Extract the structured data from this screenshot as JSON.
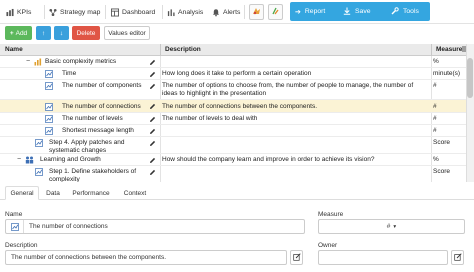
{
  "nav": {
    "kpis": "KPIs",
    "strategy_map": "Strategy map",
    "dashboard": "Dashboard",
    "analysis": "Analysis",
    "alerts": "Alerts",
    "report": "Report",
    "save": "Save",
    "tools": "Tools"
  },
  "toolbar": {
    "add": "Add",
    "delete": "Delete",
    "values_editor": "Values editor"
  },
  "table": {
    "headers": {
      "name": "Name",
      "description": "Description",
      "measure": "Measure"
    },
    "rows": [
      {
        "name": "Basic complexity metrics",
        "description": "",
        "measure": "%"
      },
      {
        "name": "Time",
        "description": "How long does it take to perform a certain operation",
        "measure": "minute(s)"
      },
      {
        "name": "The number of components",
        "description": "The number of options to choose from, the number of people to manage, the number of ideas to highlight in the presentation",
        "measure": "#"
      },
      {
        "name": "The number of connections",
        "description": "The number of connections between the components.",
        "measure": "#"
      },
      {
        "name": "The number of levels",
        "description": "The number of levels to deal with",
        "measure": "#"
      },
      {
        "name": "Shortest message length",
        "description": "",
        "measure": "#"
      },
      {
        "name": "Step 4. Apply patches and systematic changes",
        "description": "",
        "measure": "Score"
      },
      {
        "name": "Learning and Growth",
        "description": "How should the company learn and improve in order to achieve its vision?",
        "measure": "%"
      },
      {
        "name": "Step 1. Define stakeholders of complexity",
        "description": "",
        "measure": "Score"
      }
    ]
  },
  "tabs": [
    "General",
    "Data",
    "Performance",
    "Context"
  ],
  "form": {
    "name_label": "Name",
    "name_value": "The number of connections",
    "measure_label": "Measure",
    "measure_value": "#",
    "description_label": "Description",
    "description_value": "The number of connections between the components.",
    "owner_label": "Owner"
  },
  "colors": {
    "accent_blue": "#34a6e0",
    "add_green": "#5cb85c",
    "delete_red": "#e05545",
    "selected_row": "#fbf3d5"
  }
}
